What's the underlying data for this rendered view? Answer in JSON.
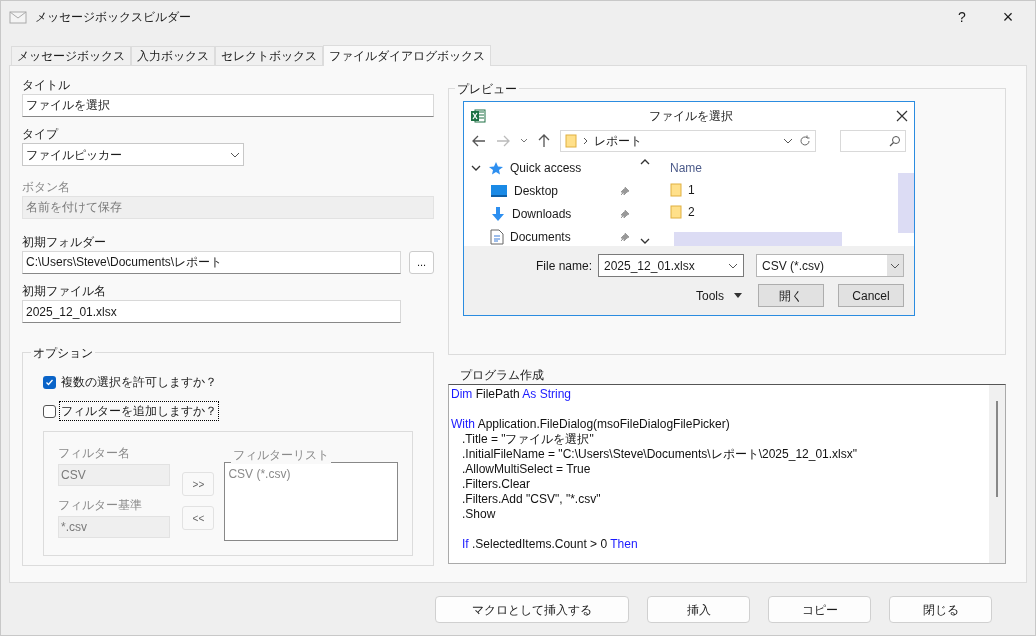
{
  "window": {
    "title": "メッセージボックスビルダー",
    "help": "?",
    "close": "×"
  },
  "tabs": [
    {
      "label": "メッセージボックス",
      "selected": false
    },
    {
      "label": "入力ボックス",
      "selected": false
    },
    {
      "label": "セレクトボックス",
      "selected": false
    },
    {
      "label": "ファイルダイアログボックス",
      "selected": true
    }
  ],
  "form": {
    "title_label": "タイトル",
    "title_value": "ファイルを選択",
    "type_label": "タイプ",
    "type_value": "ファイルピッカー",
    "button_label": "ボタン名",
    "button_value": "名前を付けて保存",
    "button_disabled": true,
    "folder_label": "初期フォルダー",
    "folder_value": "C:\\Users\\Steve\\Documents\\レポート",
    "browse": "...",
    "file_label": "初期ファイル名",
    "file_value": "2025_12_01.xlsx"
  },
  "options": {
    "title": "オプション",
    "checkboxes": [
      {
        "label": "複数の選択を許可しますか？",
        "checked": true,
        "focused": false
      },
      {
        "label": "フィルターを追加しますか？",
        "checked": false,
        "focused": true
      }
    ],
    "filter": {
      "disabled": true,
      "name_label": "フィルター名",
      "name_value": "CSV",
      "criteria_label": "フィルター基準",
      "criteria_value": "*.csv",
      "add": ">>",
      "remove": "<<",
      "list_label": "フィルターリスト",
      "list_items": [
        "CSV (*.csv)"
      ]
    }
  },
  "preview": {
    "title": "プレビュー",
    "dialog": {
      "title": "ファイルを選択",
      "path": "レポート",
      "nav": [
        {
          "label": "Quick access",
          "kind": "star",
          "expanded": true,
          "pinned": false
        },
        {
          "label": "Desktop",
          "kind": "desktop",
          "pinned": true
        },
        {
          "label": "Downloads",
          "kind": "download",
          "pinned": true
        },
        {
          "label": "Documents",
          "kind": "document",
          "pinned": true
        }
      ],
      "name_header": "Name",
      "files": [
        "1",
        "2"
      ],
      "file_name_label": "File name:",
      "file_name": "2025_12_01.xlsx",
      "file_type": "CSV (*.csv)",
      "tools": "Tools",
      "open": "開く",
      "cancel": "Cancel"
    }
  },
  "code": {
    "title": "プログラム作成",
    "lines": [
      {
        "tokens": [
          {
            "text": "Dim",
            "keyword": true
          },
          {
            "text": " FilePath ",
            "keyword": false
          },
          {
            "text": "As String",
            "keyword": true
          }
        ]
      },
      {
        "kind": "blank"
      },
      {
        "tokens": [
          {
            "text": "With",
            "keyword": true
          },
          {
            "text": " Application.FileDialog(msoFileDialogFilePicker)",
            "keyword": false
          }
        ],
        "children": [
          {
            "tokens": [
              {
                "text": ".Title = \"ファイルを選択\"",
                "keyword": false
              }
            ]
          },
          {
            "tokens": [
              {
                "text": ".InitialFileName = \"C:\\Users\\Steve\\Documents\\レポート\\2025_12_01.xlsx\"",
                "keyword": false
              }
            ]
          },
          {
            "tokens": [
              {
                "text": ".AllowMultiSelect = True",
                "keyword": false
              }
            ]
          },
          {
            "tokens": [
              {
                "text": ".Filters.Clear",
                "keyword": false
              }
            ]
          },
          {
            "tokens": [
              {
                "text": ".Filters.Add \"CSV\", \"*.csv\"",
                "keyword": false
              }
            ]
          },
          {
            "tokens": [
              {
                "text": ".Show",
                "keyword": false
              }
            ]
          },
          {
            "kind": "blank"
          },
          {
            "tokens": [
              {
                "text": "If",
                "keyword": true
              },
              {
                "text": " .SelectedItems.Count > 0 ",
                "keyword": false
              },
              {
                "text": "Then",
                "keyword": true
              }
            ]
          }
        ]
      }
    ]
  },
  "buttons": [
    "マクロとして挿入する",
    "挿入",
    "コピー",
    "閉じる"
  ]
}
